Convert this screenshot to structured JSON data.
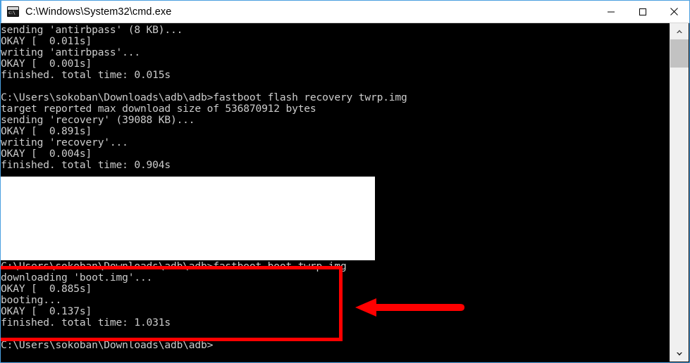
{
  "window": {
    "title": "C:\\Windows\\System32\\cmd.exe",
    "icon": "cmd-icon",
    "accent_border": "#4a9fe0",
    "background": "#000000",
    "text_color": "#cccccc"
  },
  "titlebar": {
    "minimize_label": "Minimize",
    "maximize_label": "Maximize",
    "close_label": "Close"
  },
  "console": {
    "lines": [
      "sending 'antirbpass' (8 KB)...",
      "OKAY [  0.011s]",
      "writing 'antirbpass'...",
      "OKAY [  0.001s]",
      "finished. total time: 0.015s",
      "",
      "C:\\Users\\sokoban\\Downloads\\adb\\adb>fastboot flash recovery twrp.img",
      "target reported max download size of 536870912 bytes",
      "sending 'recovery' (39088 KB)...",
      "OKAY [  0.891s]",
      "writing 'recovery'...",
      "OKAY [  0.004s]",
      "finished. total time: 0.904s",
      "",
      "",
      "",
      "",
      "",
      "",
      "",
      "",
      "C:\\Users\\sokoban\\Downloads\\adb\\adb>fastboot boot twrp.img",
      "downloading 'boot.img'...",
      "OKAY [  0.885s]",
      "booting...",
      "OKAY [  0.137s]",
      "finished. total time: 1.031s",
      "",
      "C:\\Users\\sokoban\\Downloads\\adb\\adb>"
    ]
  },
  "annotations": {
    "highlight_box_color": "#ff0000",
    "arrow_color": "#ff0000",
    "arrow_direction": "left"
  },
  "scrollbar": {
    "up_arrow": "chevron-up-icon",
    "down_arrow": "chevron-down-icon",
    "thumb_color": "#c2c2c2",
    "track_color": "#f0f0f0"
  }
}
